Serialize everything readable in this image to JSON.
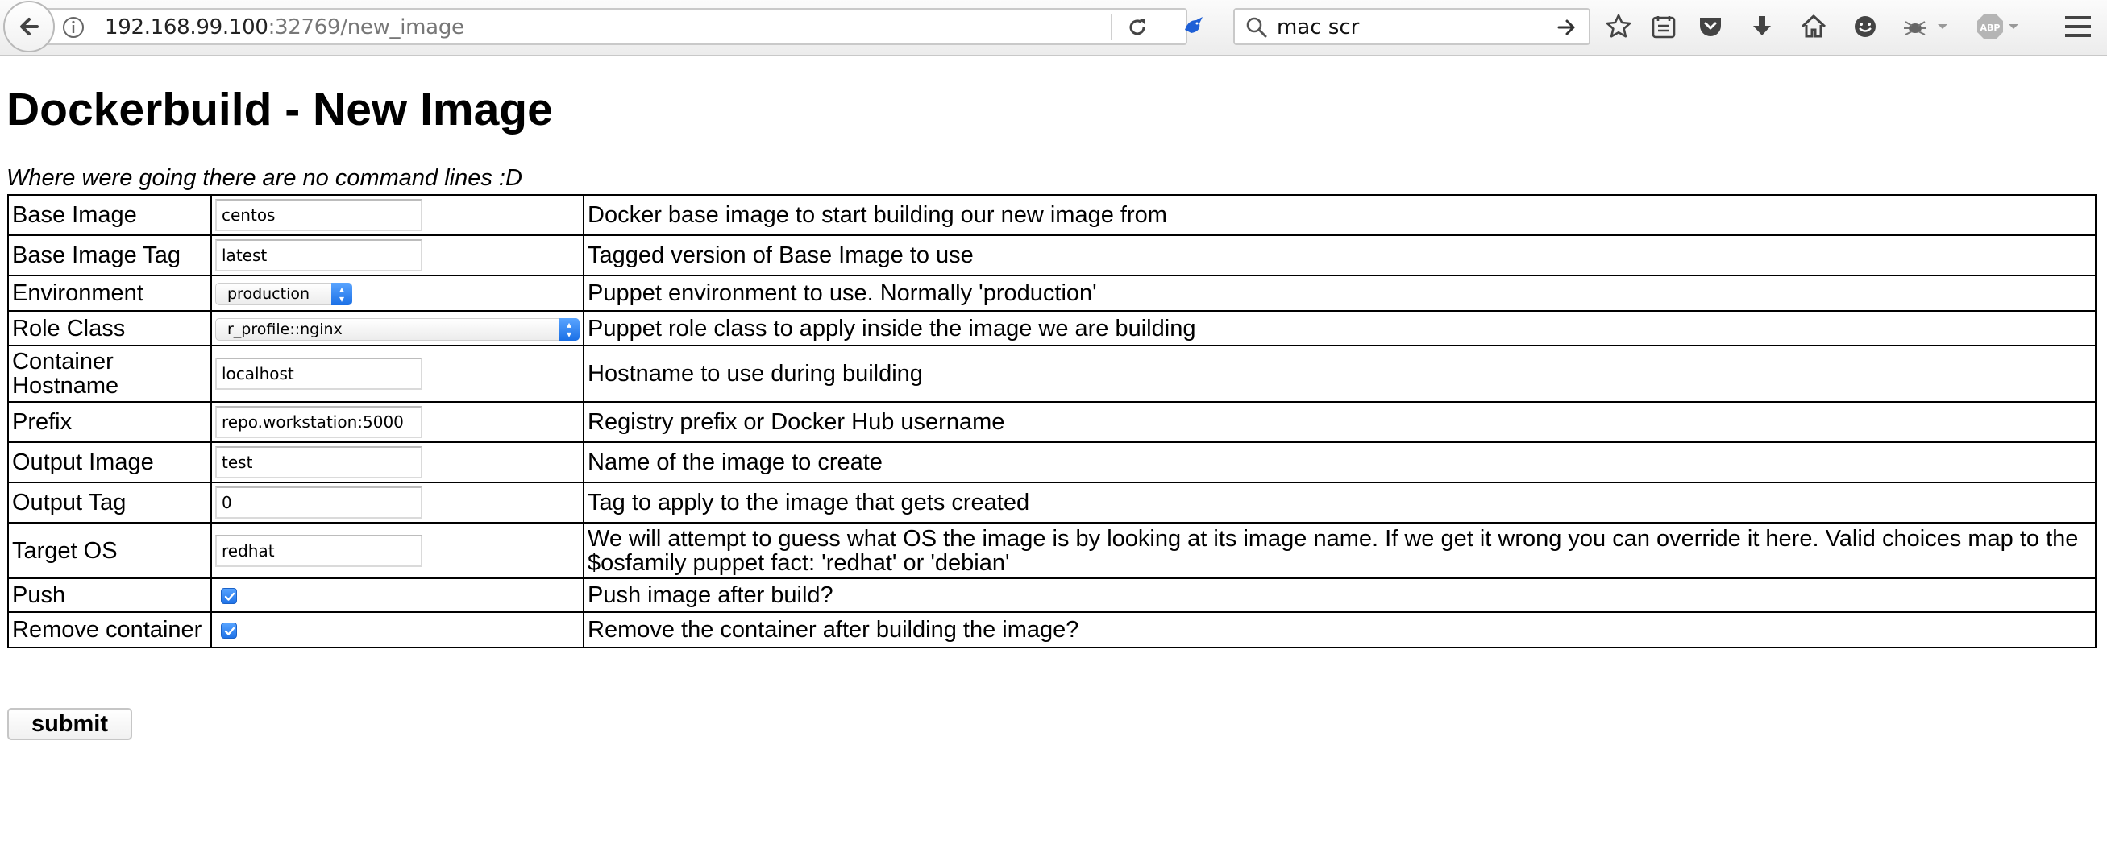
{
  "browser": {
    "url_host": "192.168.99.100",
    "url_rest": ":32769/new_image",
    "search_text": "mac scr"
  },
  "page": {
    "title": "Dockerbuild - New Image",
    "tagline": "Where were going there are no command lines :D",
    "submit_label": "submit"
  },
  "rows": [
    {
      "label": "Base Image",
      "value": "centos",
      "description": "Docker base image to start building our new image from"
    },
    {
      "label": "Base Image Tag",
      "value": "latest",
      "description": "Tagged version of Base Image to use"
    },
    {
      "label": "Environment",
      "value": "production",
      "description": "Puppet environment to use. Normally 'production'"
    },
    {
      "label": "Role Class",
      "value": "r_profile::nginx",
      "description": "Puppet role class to apply inside the image we are building"
    },
    {
      "label": "Container Hostname",
      "value": "localhost",
      "description": "Hostname to use during building"
    },
    {
      "label": "Prefix",
      "value": "repo.workstation:5000",
      "description": "Registry prefix or Docker Hub username"
    },
    {
      "label": "Output Image",
      "value": "test",
      "description": "Name of the image to create"
    },
    {
      "label": "Output Tag",
      "value": "0",
      "description": "Tag to apply to the image that gets created"
    },
    {
      "label": "Target OS",
      "value": "redhat",
      "description": "We will attempt to guess what OS the image is by looking at its image name. If we get it wrong you can override it here. Valid choices map to the $osfamily puppet fact: 'redhat' or 'debian'"
    },
    {
      "label": "Push",
      "checked": true,
      "description": "Push image after build?"
    },
    {
      "label": "Remove container",
      "checked": true,
      "description": "Remove the container after building the image?"
    }
  ]
}
